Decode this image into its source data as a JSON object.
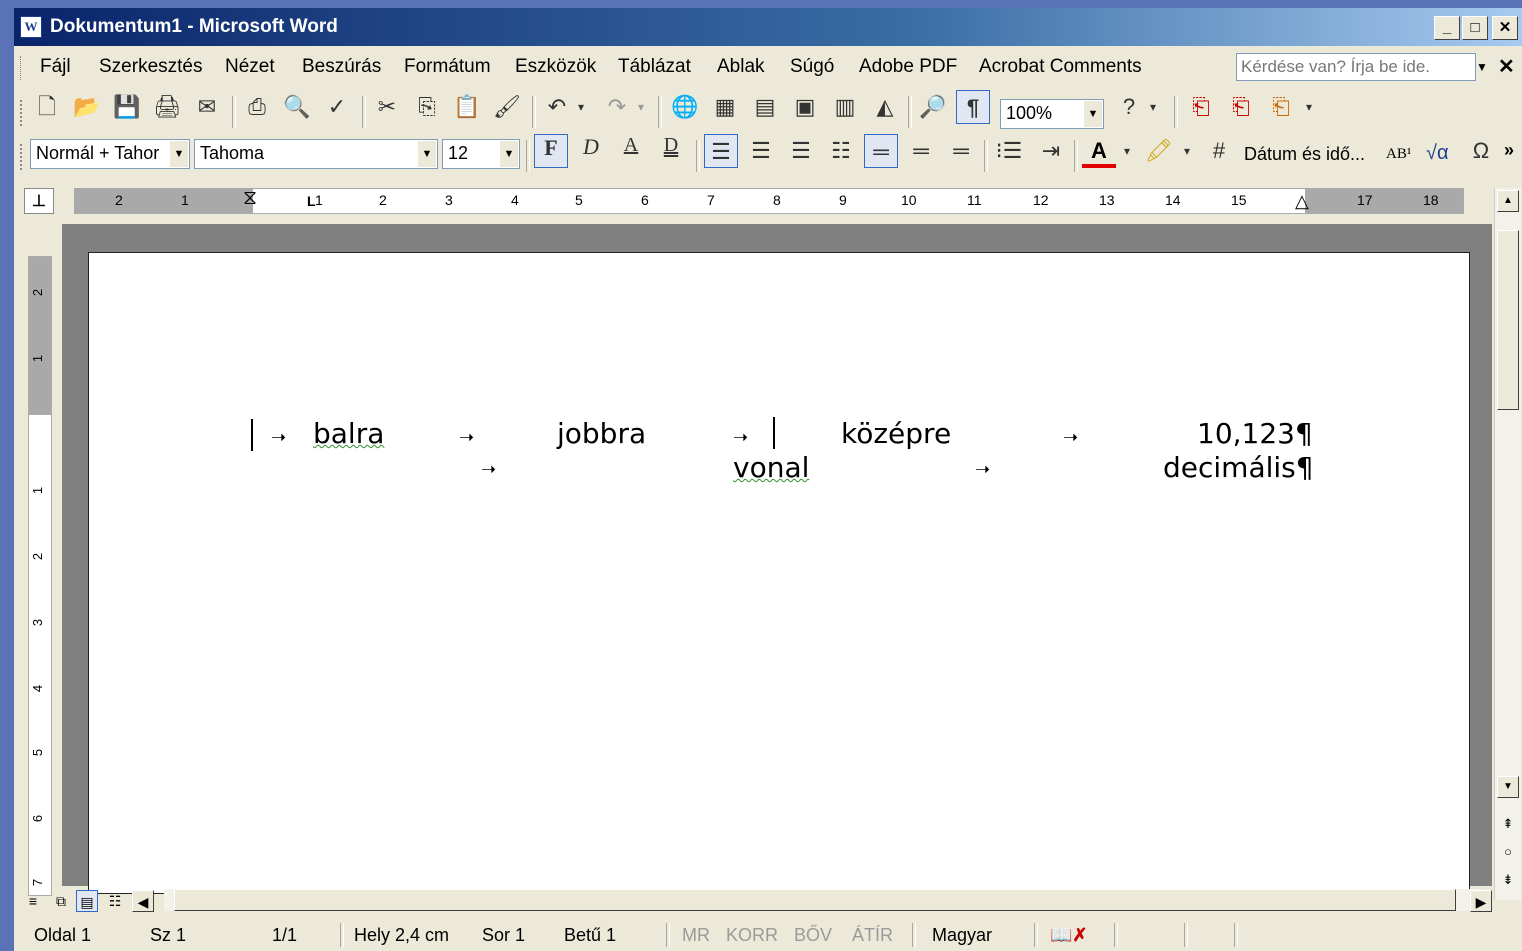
{
  "window": {
    "title": "Dokumentum1 - Microsoft Word",
    "icon_letter": "W",
    "minimize": "_",
    "maximize": "□",
    "close": "✕"
  },
  "menu": {
    "items": [
      "Fájl",
      "Szerkesztés",
      "Nézet",
      "Beszúrás",
      "Formátum",
      "Eszközök",
      "Táblázat",
      "Ablak",
      "Súgó",
      "Adobe PDF",
      "Acrobat Comments"
    ],
    "ask_placeholder": "Kérdése van? Írja be ide.",
    "close": "✕"
  },
  "standard_toolbar": {
    "zoom": "100%",
    "pilcrow": "¶"
  },
  "formatting_toolbar": {
    "style": "Normál + Tahor",
    "font": "Tahoma",
    "size": "12",
    "bold": "F",
    "italic": "D",
    "underline": "A",
    "double_underline": "D",
    "date_time": "Dátum és idő...",
    "superscript": "AB¹",
    "equation": "√α",
    "more": "»"
  },
  "ruler": {
    "corner_symbol": "⊥",
    "h_numbers": [
      "2",
      "1",
      "1",
      "2",
      "3",
      "4",
      "5",
      "6",
      "7",
      "8",
      "9",
      "10",
      "11",
      "12",
      "13",
      "14",
      "15",
      "17",
      "18"
    ],
    "v_numbers": [
      "2",
      "1",
      "1",
      "2",
      "3",
      "4",
      "5",
      "6",
      "7"
    ]
  },
  "document": {
    "line1": {
      "left": "balra",
      "right": "jobbra",
      "center": "középre",
      "decimal": "10,123¶"
    },
    "line2": {
      "bar": "vonal",
      "decimal": "decimális¶"
    },
    "tab_arrow": "➝"
  },
  "statusbar": {
    "page": "Oldal 1",
    "section": "Sz 1",
    "pages": "1/1",
    "position": "Hely 2,4 cm",
    "line": "Sor 1",
    "column": "Betű 1",
    "mr": "MR",
    "korr": "KORR",
    "bov": "BŐV",
    "atir": "ÁTÍR",
    "language": "Magyar"
  }
}
